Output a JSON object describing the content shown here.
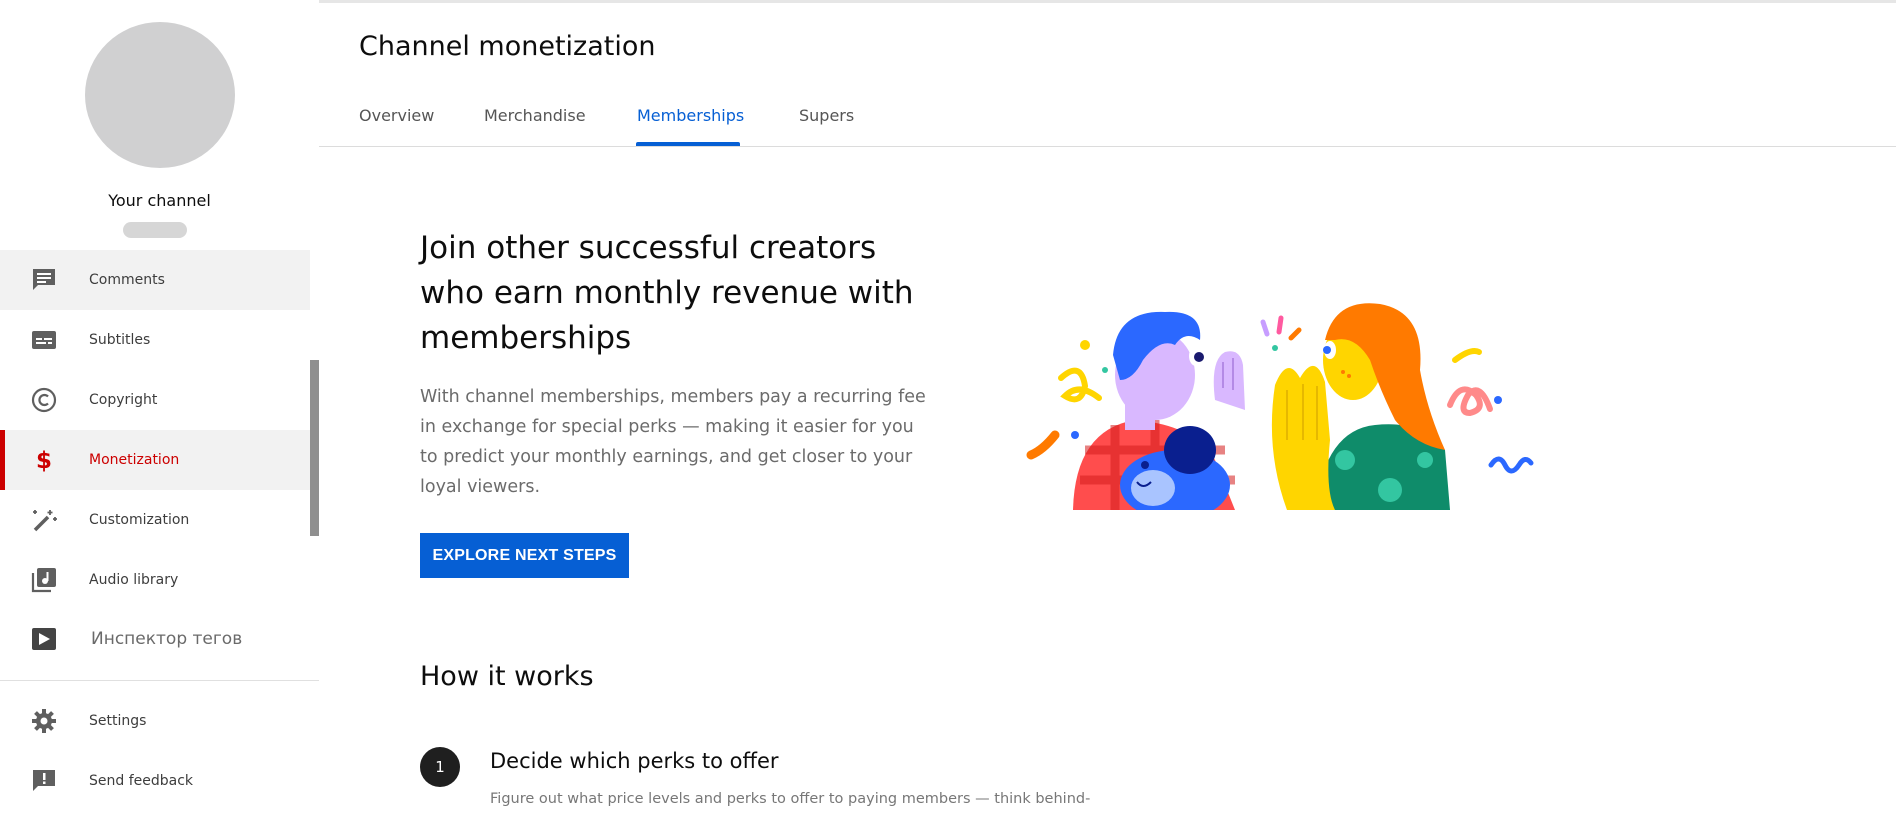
{
  "sidebar": {
    "channel_label": "Your channel",
    "items": [
      {
        "label": "Comments",
        "icon": "comment-icon"
      },
      {
        "label": "Subtitles",
        "icon": "subtitles-icon"
      },
      {
        "label": "Copyright",
        "icon": "copyright-icon"
      },
      {
        "label": "Monetization",
        "icon": "dollar-icon",
        "active": true
      },
      {
        "label": "Customization",
        "icon": "magic-wand-icon"
      },
      {
        "label": "Audio library",
        "icon": "audio-library-icon"
      },
      {
        "label": "Инспектор тегов",
        "icon": "tag-inspector-icon"
      },
      {
        "label": "Settings",
        "icon": "gear-icon"
      },
      {
        "label": "Send feedback",
        "icon": "feedback-icon"
      }
    ]
  },
  "header": {
    "title": "Channel monetization",
    "tabs": [
      {
        "label": "Overview"
      },
      {
        "label": "Merchandise"
      },
      {
        "label": "Memberships",
        "active": true
      },
      {
        "label": "Supers"
      }
    ]
  },
  "hero": {
    "heading": "Join other successful creators who earn monthly revenue with memberships",
    "body": "With channel memberships, members pay a recurring fee in exchange for special perks — making it easier for you to predict your monthly earnings, and get closer to your loyal viewers.",
    "cta_label": "EXPLORE NEXT STEPS"
  },
  "how": {
    "title": "How it works",
    "steps": [
      {
        "number": "1",
        "title": "Decide which perks to offer",
        "body": "Figure out what price levels and perks to offer to paying members — think behind-"
      }
    ]
  },
  "colors": {
    "accent": "#065fd4",
    "active_nav": "#cc0000"
  }
}
